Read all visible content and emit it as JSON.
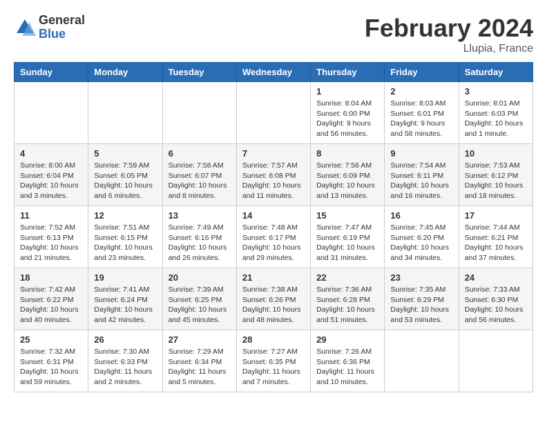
{
  "header": {
    "logo_general": "General",
    "logo_blue": "Blue",
    "title": "February 2024",
    "location": "Llupia, France"
  },
  "days_of_week": [
    "Sunday",
    "Monday",
    "Tuesday",
    "Wednesday",
    "Thursday",
    "Friday",
    "Saturday"
  ],
  "weeks": [
    [
      {
        "day": "",
        "info": ""
      },
      {
        "day": "",
        "info": ""
      },
      {
        "day": "",
        "info": ""
      },
      {
        "day": "",
        "info": ""
      },
      {
        "day": "1",
        "info": "Sunrise: 8:04 AM\nSunset: 6:00 PM\nDaylight: 9 hours and 56 minutes."
      },
      {
        "day": "2",
        "info": "Sunrise: 8:03 AM\nSunset: 6:01 PM\nDaylight: 9 hours and 58 minutes."
      },
      {
        "day": "3",
        "info": "Sunrise: 8:01 AM\nSunset: 6:03 PM\nDaylight: 10 hours and 1 minute."
      }
    ],
    [
      {
        "day": "4",
        "info": "Sunrise: 8:00 AM\nSunset: 6:04 PM\nDaylight: 10 hours and 3 minutes."
      },
      {
        "day": "5",
        "info": "Sunrise: 7:59 AM\nSunset: 6:05 PM\nDaylight: 10 hours and 6 minutes."
      },
      {
        "day": "6",
        "info": "Sunrise: 7:58 AM\nSunset: 6:07 PM\nDaylight: 10 hours and 8 minutes."
      },
      {
        "day": "7",
        "info": "Sunrise: 7:57 AM\nSunset: 6:08 PM\nDaylight: 10 hours and 11 minutes."
      },
      {
        "day": "8",
        "info": "Sunrise: 7:56 AM\nSunset: 6:09 PM\nDaylight: 10 hours and 13 minutes."
      },
      {
        "day": "9",
        "info": "Sunrise: 7:54 AM\nSunset: 6:11 PM\nDaylight: 10 hours and 16 minutes."
      },
      {
        "day": "10",
        "info": "Sunrise: 7:53 AM\nSunset: 6:12 PM\nDaylight: 10 hours and 18 minutes."
      }
    ],
    [
      {
        "day": "11",
        "info": "Sunrise: 7:52 AM\nSunset: 6:13 PM\nDaylight: 10 hours and 21 minutes."
      },
      {
        "day": "12",
        "info": "Sunrise: 7:51 AM\nSunset: 6:15 PM\nDaylight: 10 hours and 23 minutes."
      },
      {
        "day": "13",
        "info": "Sunrise: 7:49 AM\nSunset: 6:16 PM\nDaylight: 10 hours and 26 minutes."
      },
      {
        "day": "14",
        "info": "Sunrise: 7:48 AM\nSunset: 6:17 PM\nDaylight: 10 hours and 29 minutes."
      },
      {
        "day": "15",
        "info": "Sunrise: 7:47 AM\nSunset: 6:19 PM\nDaylight: 10 hours and 31 minutes."
      },
      {
        "day": "16",
        "info": "Sunrise: 7:45 AM\nSunset: 6:20 PM\nDaylight: 10 hours and 34 minutes."
      },
      {
        "day": "17",
        "info": "Sunrise: 7:44 AM\nSunset: 6:21 PM\nDaylight: 10 hours and 37 minutes."
      }
    ],
    [
      {
        "day": "18",
        "info": "Sunrise: 7:42 AM\nSunset: 6:22 PM\nDaylight: 10 hours and 40 minutes."
      },
      {
        "day": "19",
        "info": "Sunrise: 7:41 AM\nSunset: 6:24 PM\nDaylight: 10 hours and 42 minutes."
      },
      {
        "day": "20",
        "info": "Sunrise: 7:39 AM\nSunset: 6:25 PM\nDaylight: 10 hours and 45 minutes."
      },
      {
        "day": "21",
        "info": "Sunrise: 7:38 AM\nSunset: 6:26 PM\nDaylight: 10 hours and 48 minutes."
      },
      {
        "day": "22",
        "info": "Sunrise: 7:36 AM\nSunset: 6:28 PM\nDaylight: 10 hours and 51 minutes."
      },
      {
        "day": "23",
        "info": "Sunrise: 7:35 AM\nSunset: 6:29 PM\nDaylight: 10 hours and 53 minutes."
      },
      {
        "day": "24",
        "info": "Sunrise: 7:33 AM\nSunset: 6:30 PM\nDaylight: 10 hours and 56 minutes."
      }
    ],
    [
      {
        "day": "25",
        "info": "Sunrise: 7:32 AM\nSunset: 6:31 PM\nDaylight: 10 hours and 59 minutes."
      },
      {
        "day": "26",
        "info": "Sunrise: 7:30 AM\nSunset: 6:33 PM\nDaylight: 11 hours and 2 minutes."
      },
      {
        "day": "27",
        "info": "Sunrise: 7:29 AM\nSunset: 6:34 PM\nDaylight: 11 hours and 5 minutes."
      },
      {
        "day": "28",
        "info": "Sunrise: 7:27 AM\nSunset: 6:35 PM\nDaylight: 11 hours and 7 minutes."
      },
      {
        "day": "29",
        "info": "Sunrise: 7:26 AM\nSunset: 6:36 PM\nDaylight: 11 hours and 10 minutes."
      },
      {
        "day": "",
        "info": ""
      },
      {
        "day": "",
        "info": ""
      }
    ]
  ]
}
